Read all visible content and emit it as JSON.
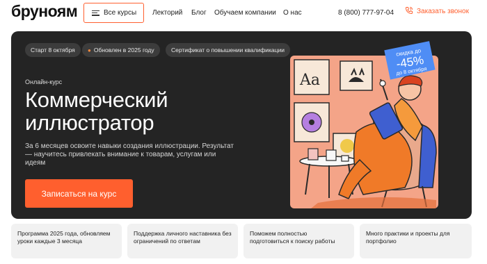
{
  "header": {
    "logo": "бруноям",
    "courses_button": "Все курсы",
    "nav": [
      "Лекторий",
      "Блог",
      "Обучаем компании",
      "О нас"
    ],
    "phone": "8 (800) 777-97-04",
    "callback": "Заказать звонок"
  },
  "hero": {
    "chips": [
      "Старт 8 октября",
      "Обновлен в 2025 году",
      "Сертификат о повышении квалификации"
    ],
    "kicker": "Онлайн-курс",
    "title": "Коммерческий иллюстратор",
    "description": "За 6 месяцев освоите навыки создания иллюстрации. Результат — научитесь привлекать внимание к товарам, услугам или идеям",
    "cta": "Записаться на курс",
    "badge": {
      "top": "скидка до",
      "value": "-45%",
      "bottom": "до 8 октября"
    }
  },
  "features": [
    "Программа 2025 года, обновляем уроки каждые 3 месяца",
    "Поддержка личного наставника без ограничений по ответам",
    "Поможем полностью подготовиться к поиску работы",
    "Много практики и проекты для портфолио"
  ],
  "colors": {
    "accent": "#ff5f2e",
    "hero_bg": "#242424",
    "badge": "#4f8df5",
    "feature_bg": "#f1f1f1"
  }
}
